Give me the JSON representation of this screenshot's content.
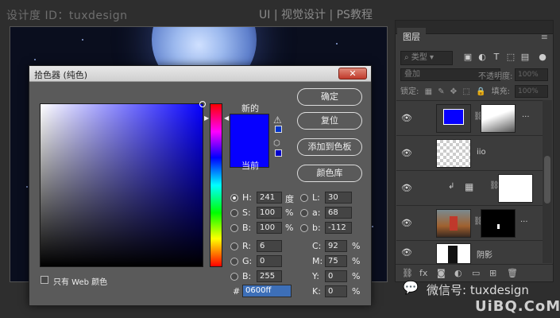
{
  "watermark": {
    "designer": "设计度 ID：tuxdesign",
    "categories": "UI | 视觉设计 | PS教程",
    "wechat": "微信号: tuxdesign",
    "site": "UiBQ.CoM"
  },
  "layers_panel": {
    "tab": "图层",
    "menu_icon": "≡",
    "filter_kind": "类型",
    "blend_mode": "叠加",
    "opacity_label": "不透明度:",
    "opacity_value": "100%",
    "lock_label": "锁定:",
    "fill_label": "填充:",
    "fill_value": "100%",
    "layers": [
      {
        "name": "...",
        "visible": true,
        "thumb": "blue-screen",
        "mask": true
      },
      {
        "name": "iio",
        "visible": true,
        "thumb": "transparent",
        "mask": false
      },
      {
        "name": "",
        "visible": true,
        "thumb": "adjust",
        "mask": true
      },
      {
        "name": "...",
        "visible": true,
        "thumb": "photo",
        "mask": true
      },
      {
        "name": "阴影",
        "visible": true,
        "thumb": "figure",
        "mask": false
      }
    ]
  },
  "color_picker": {
    "title": "拾色器 (纯色)",
    "close": "✕",
    "new_label": "新的",
    "current_label": "当前",
    "buttons": {
      "ok": "确定",
      "reset": "复位",
      "add_swatch": "添加到色板",
      "color_library": "颜色库"
    },
    "hsb": {
      "h_label": "H:",
      "h_value": "241",
      "h_unit": "度",
      "s_label": "S:",
      "s_value": "100",
      "s_unit": "%",
      "b_label": "B:",
      "b_value": "100",
      "b_unit": "%"
    },
    "rgb": {
      "r_label": "R:",
      "r_value": "6",
      "g_label": "G:",
      "g_value": "0",
      "b_label": "B:",
      "b_value": "255"
    },
    "lab": {
      "l_label": "L:",
      "l_value": "30",
      "a_label": "a:",
      "a_value": "68",
      "b_label": "b:",
      "b_value": "-112"
    },
    "cmyk": {
      "c_label": "C:",
      "c_value": "92",
      "m_label": "M:",
      "m_value": "75",
      "y_label": "Y:",
      "y_value": "0",
      "k_label": "K:",
      "k_value": "0",
      "unit": "%"
    },
    "hex_label": "#",
    "hex_value": "0600ff",
    "web_only_label": "只有 Web 颜色",
    "selected_radio": "H",
    "colors": {
      "new": "#0600ff",
      "current": "#0600ff"
    }
  }
}
